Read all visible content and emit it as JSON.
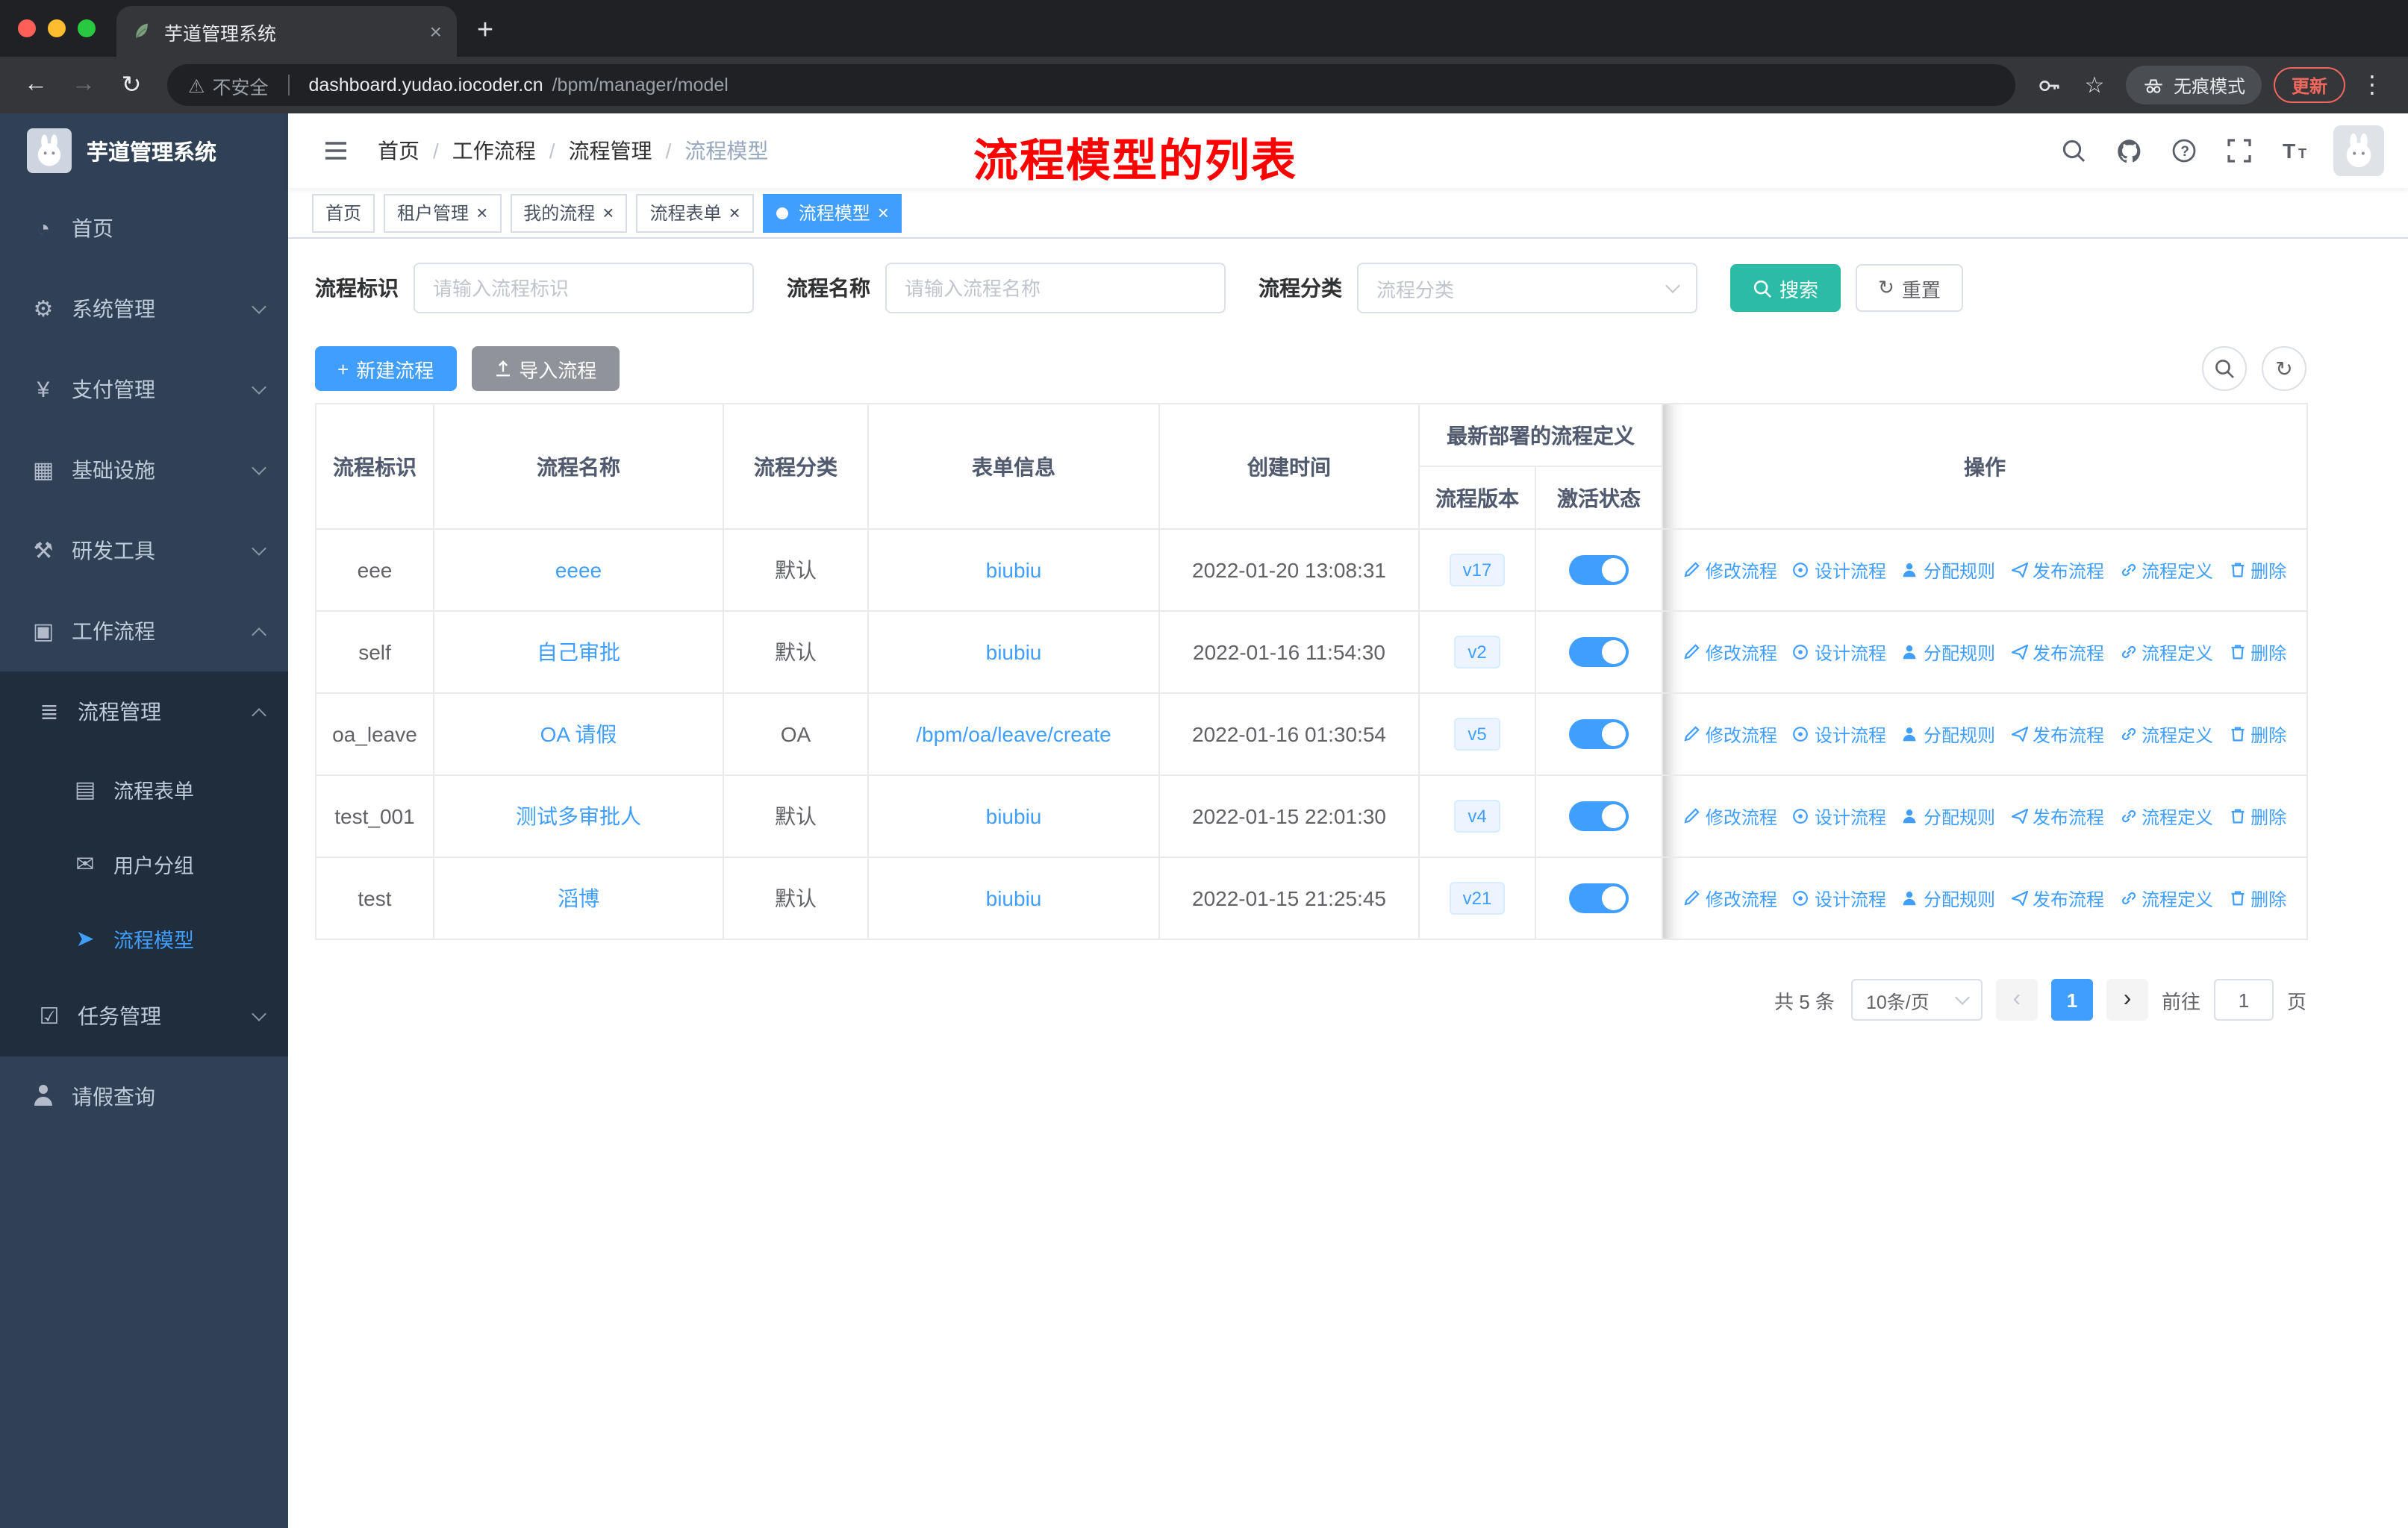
{
  "browser": {
    "tab_title": "芋道管理系统",
    "security_label": "不安全",
    "url_domain": "dashboard.yudao.iocoder.cn",
    "url_path": "/bpm/manager/model",
    "incognito_label": "无痕模式",
    "update_label": "更新"
  },
  "icons": {
    "new_tab": "+",
    "tab_close": "×",
    "tag_close": "×",
    "back": "←",
    "forward": "→",
    "reload": "↻",
    "star": "☆",
    "kebab": "⋮",
    "warning": "⚠",
    "plus": "+",
    "refresh": "↻"
  },
  "sidebar": {
    "logo_title": "芋道管理系统",
    "items": [
      {
        "label": "首页",
        "icon": "dashboard-icon",
        "glyph": "◔"
      },
      {
        "label": "系统管理",
        "icon": "system-gear-icon",
        "glyph": "⚙"
      },
      {
        "label": "支付管理",
        "icon": "payment-yen-icon",
        "glyph": "¥"
      },
      {
        "label": "基础设施",
        "icon": "infrastructure-icon",
        "glyph": "▦"
      },
      {
        "label": "研发工具",
        "icon": "dev-tools-icon",
        "glyph": "⚒"
      },
      {
        "label": "工作流程",
        "icon": "workflow-icon",
        "glyph": "▣"
      },
      {
        "label": "流程管理",
        "icon": "process-management-icon",
        "glyph": "≣"
      },
      {
        "label": "流程表单",
        "icon": "process-form-icon",
        "glyph": "▤"
      },
      {
        "label": "用户分组",
        "icon": "user-group-icon",
        "glyph": "✉"
      },
      {
        "label": "流程模型",
        "icon": "process-model-icon",
        "glyph": "➤"
      },
      {
        "label": "任务管理",
        "icon": "task-management-icon",
        "glyph": "☑"
      },
      {
        "label": "请假查询",
        "icon": "leave-person-icon",
        "glyph": ""
      }
    ]
  },
  "navbar": {
    "breadcrumb": [
      "首页",
      "工作流程",
      "流程管理",
      "流程模型"
    ],
    "separator": "/",
    "annotation": "流程模型的列表"
  },
  "tags": [
    {
      "label": "首页"
    },
    {
      "label": "租户管理"
    },
    {
      "label": "我的流程"
    },
    {
      "label": "流程表单"
    },
    {
      "label": "流程模型"
    }
  ],
  "filters": {
    "id_label": "流程标识",
    "id_placeholder": "请输入流程标识",
    "name_label": "流程名称",
    "name_placeholder": "请输入流程名称",
    "category_label": "流程分类",
    "category_placeholder": "流程分类",
    "search_button": "搜索",
    "reset_button": "重置"
  },
  "toolbar": {
    "create_button": "新建流程",
    "import_button": "导入流程"
  },
  "table": {
    "headers": {
      "id": "流程标识",
      "name": "流程名称",
      "category": "流程分类",
      "form": "表单信息",
      "created": "创建时间",
      "deployment_group": "最新部署的流程定义",
      "version": "流程版本",
      "active": "激活状态",
      "ops": "操作"
    },
    "rows": [
      {
        "id": "eee",
        "name": "eeee",
        "category": "默认",
        "form": "biubiu",
        "created": "2022-01-20 13:08:31",
        "version": "v17",
        "active": true
      },
      {
        "id": "self",
        "name": "自己审批",
        "category": "默认",
        "form": "biubiu",
        "created": "2022-01-16 11:54:30",
        "version": "v2",
        "active": true
      },
      {
        "id": "oa_leave",
        "name": "OA 请假",
        "category": "OA",
        "form": "/bpm/oa/leave/create",
        "created": "2022-01-16 01:30:54",
        "version": "v5",
        "active": true
      },
      {
        "id": "test_001",
        "name": "测试多审批人",
        "category": "默认",
        "form": "biubiu",
        "created": "2022-01-15 22:01:30",
        "version": "v4",
        "active": true
      },
      {
        "id": "test",
        "name": "滔博",
        "category": "默认",
        "form": "biubiu",
        "created": "2022-01-15 21:25:45",
        "version": "v21",
        "active": true
      }
    ],
    "actions": [
      {
        "name": "edit",
        "label": "修改流程"
      },
      {
        "name": "design",
        "label": "设计流程"
      },
      {
        "name": "assign",
        "label": "分配规则"
      },
      {
        "name": "publish",
        "label": "发布流程"
      },
      {
        "name": "definition",
        "label": "流程定义"
      },
      {
        "name": "delete",
        "label": "删除"
      }
    ]
  },
  "pagination": {
    "total": "共 5 条",
    "page_size": "10条/页",
    "prev": "‹",
    "page": "1",
    "next": "›",
    "goto_label": "前往",
    "goto_value": "1",
    "unit_label": "页"
  },
  "colors": {
    "primary": "#409EFF",
    "search_teal": "#2CBCA5",
    "info_gray": "#909399",
    "sidebar_bg": "#304156",
    "submenu_bg": "#1f2d3d",
    "annotation_red": "#FF0000"
  }
}
